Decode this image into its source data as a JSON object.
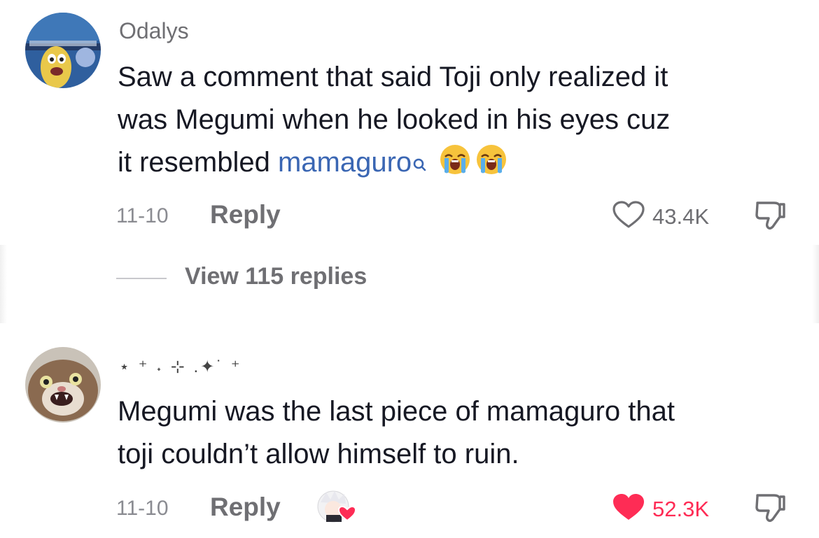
{
  "comments": [
    {
      "username": "Odalys",
      "text_lines": [
        "Saw a comment that said Toji only realized it",
        "was Megumi when he looked in his eyes cuz"
      ],
      "line3_prefix": "it resembled ",
      "link_text": "mamaguro",
      "emojis": [
        "loudly-crying-face",
        "loudly-crying-face"
      ],
      "date": "11-10",
      "reply_label": "Reply",
      "like_count": "43.4K",
      "liked": false,
      "view_replies": "View 115 replies"
    },
    {
      "username": "⋆ ⁺ ˖ ⊹ .✦˙ ⁺",
      "text_lines": [
        "Megumi was the last piece of mamaguro that",
        "toji couldn’t allow himself to ruin."
      ],
      "date": "11-10",
      "reply_label": "Reply",
      "like_count": "52.3K",
      "liked": true,
      "creator_liked": true
    }
  ],
  "colors": {
    "link": "#3a66b3",
    "like_active": "#fe2c55",
    "muted": "#6f6f73"
  }
}
